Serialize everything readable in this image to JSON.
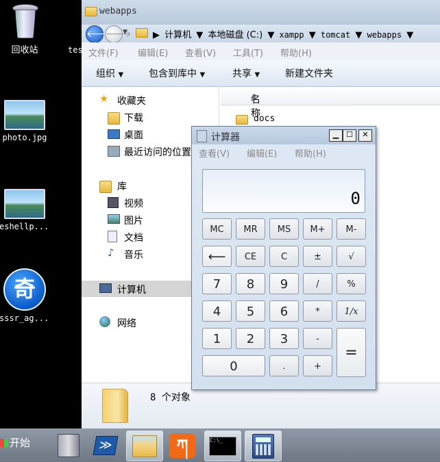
{
  "desktop": {
    "icons": [
      {
        "label": "回收站"
      },
      {
        "label": "photo.jpg"
      },
      {
        "label": "eshellp..."
      },
      {
        "label": "sssr_ag..."
      }
    ],
    "partial_label": "tes",
    "qihoo_glyph": "奇"
  },
  "explorer": {
    "title": "webapps",
    "breadcrumb": [
      "计算机",
      "本地磁盘 (C:)",
      "xampp",
      "tomcat",
      "webapps"
    ],
    "menu": [
      "文件(F)",
      "编辑(E)",
      "查看(V)",
      "工具(T)",
      "帮助(H)"
    ],
    "toolbar": {
      "organize": "组织",
      "include": "包含到库中",
      "share": "共享",
      "new_folder": "新建文件夹"
    },
    "nav": {
      "favorites": "收藏夹",
      "downloads": "下载",
      "desktop": "桌面",
      "recent": "最近访问的位置",
      "library": "库",
      "videos": "视频",
      "pictures": "图片",
      "documents": "文档",
      "music": "音乐",
      "computer": "计算机",
      "network": "网络"
    },
    "column_name": "名称",
    "files": [
      {
        "name": "docs"
      }
    ],
    "details": "8 个对象"
  },
  "calculator": {
    "title": "计算器",
    "menu": [
      "查看(V)",
      "编辑(E)",
      "帮助(H)"
    ],
    "display": "0",
    "keys": {
      "mc": "MC",
      "mr": "MR",
      "ms": "MS",
      "mplus": "M+",
      "mminus": "M-",
      "back": "⟵",
      "ce": "CE",
      "c": "C",
      "pm": "±",
      "sqrt": "√",
      "n7": "7",
      "n8": "8",
      "n9": "9",
      "div": "/",
      "pct": "%",
      "n4": "4",
      "n5": "5",
      "n6": "6",
      "mul": "*",
      "inv": "1/x",
      "n1": "1",
      "n2": "2",
      "n3": "3",
      "sub": "-",
      "eq": "=",
      "n0": "0",
      "dot": ".",
      "add": "+"
    }
  },
  "taskbar": {
    "start": "开始",
    "terminal_text": "C:\\_"
  }
}
